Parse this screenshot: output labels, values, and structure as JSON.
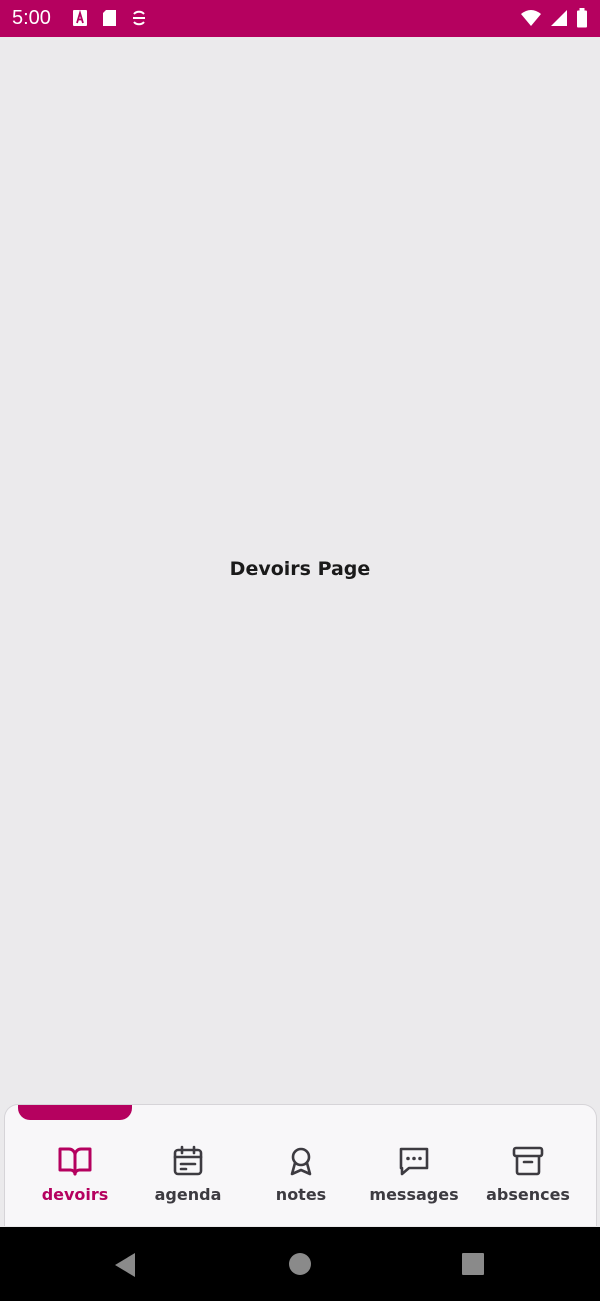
{
  "status_bar": {
    "time": "5:00",
    "background": "#b5015f",
    "left_icons": [
      "a-badge-icon",
      "sd-card-icon",
      "sync-icon"
    ],
    "right_icons": [
      "wifi-icon",
      "cell-signal-icon",
      "battery-icon"
    ]
  },
  "main": {
    "title": "Devoirs Page"
  },
  "bottom_nav": {
    "accent_color": "#b5015f",
    "active_index": 0,
    "items": [
      {
        "label": "devoirs",
        "icon": "book-open-icon"
      },
      {
        "label": "agenda",
        "icon": "calendar-icon"
      },
      {
        "label": "notes",
        "icon": "award-icon"
      },
      {
        "label": "messages",
        "icon": "message-square-icon"
      },
      {
        "label": "absences",
        "icon": "archive-icon"
      }
    ]
  },
  "system_nav": {
    "buttons": [
      "back-icon",
      "home-icon",
      "recents-icon"
    ]
  }
}
